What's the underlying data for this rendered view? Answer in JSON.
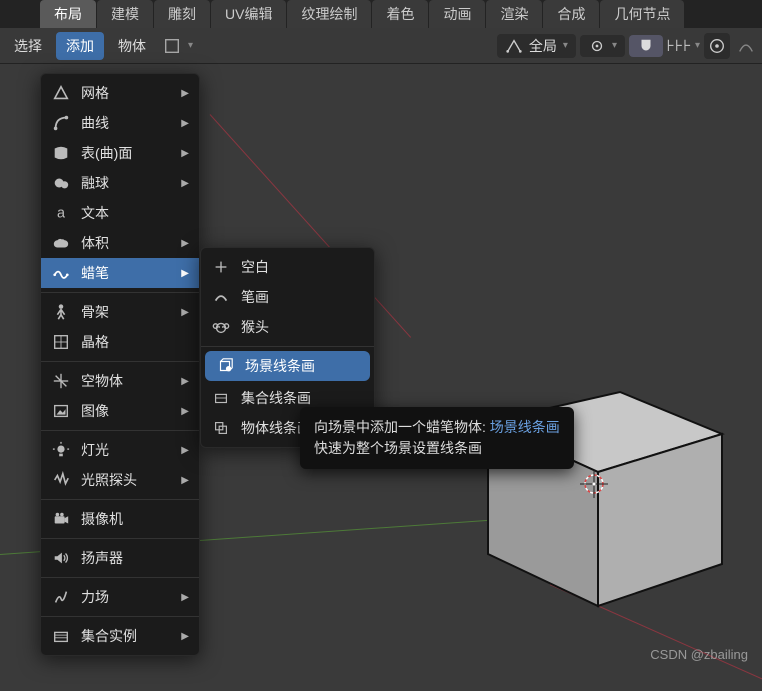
{
  "tabs": [
    "布局",
    "建模",
    "雕刻",
    "UV编辑",
    "纹理绘制",
    "着色",
    "动画",
    "渲染",
    "合成",
    "几何节点"
  ],
  "active_tab": 0,
  "toolbar": {
    "select": "选择",
    "add": "添加",
    "object": "物体",
    "orientation": "全局"
  },
  "add_menu": [
    {
      "icon": "triangle",
      "label": "网格",
      "sub": true
    },
    {
      "icon": "curve",
      "label": "曲线",
      "sub": true
    },
    {
      "icon": "surface",
      "label": "表(曲)面",
      "sub": true
    },
    {
      "icon": "metaball",
      "label": "融球",
      "sub": true
    },
    {
      "icon": "text",
      "label": "文本",
      "sub": false
    },
    {
      "icon": "volume",
      "label": "体积",
      "sub": true
    },
    {
      "icon": "gpencil",
      "label": "蜡笔",
      "sub": true,
      "highlight": true
    },
    {
      "sep": true
    },
    {
      "icon": "armature",
      "label": "骨架",
      "sub": true
    },
    {
      "icon": "lattice",
      "label": "晶格",
      "sub": false
    },
    {
      "sep": true
    },
    {
      "icon": "empty",
      "label": "空物体",
      "sub": true
    },
    {
      "icon": "image",
      "label": "图像",
      "sub": true
    },
    {
      "sep": true
    },
    {
      "icon": "light",
      "label": "灯光",
      "sub": true
    },
    {
      "icon": "lightprobe",
      "label": "光照探头",
      "sub": true
    },
    {
      "sep": true
    },
    {
      "icon": "camera",
      "label": "摄像机",
      "sub": false
    },
    {
      "sep": true
    },
    {
      "icon": "speaker",
      "label": "扬声器",
      "sub": false
    },
    {
      "sep": true
    },
    {
      "icon": "force",
      "label": "力场",
      "sub": true
    },
    {
      "sep": true
    },
    {
      "icon": "collection",
      "label": "集合实例",
      "sub": true
    }
  ],
  "gp_submenu": [
    {
      "icon": "blank",
      "label": "空白"
    },
    {
      "icon": "stroke",
      "label": "笔画"
    },
    {
      "icon": "monkey",
      "label": "猴头"
    },
    {
      "sep": true
    },
    {
      "icon": "lineart",
      "label": "场景线条画",
      "selected": true
    },
    {
      "icon": "lineart2",
      "label": "集合线条画"
    },
    {
      "icon": "lineart3",
      "label": "物体线条画"
    }
  ],
  "tooltip": {
    "line1_pre": "向场景中添加一个蜡笔物体: ",
    "line1_link": "场景线条画",
    "line2": "快速为整个场景设置线条画"
  },
  "watermark": "CSDN @zbailing"
}
